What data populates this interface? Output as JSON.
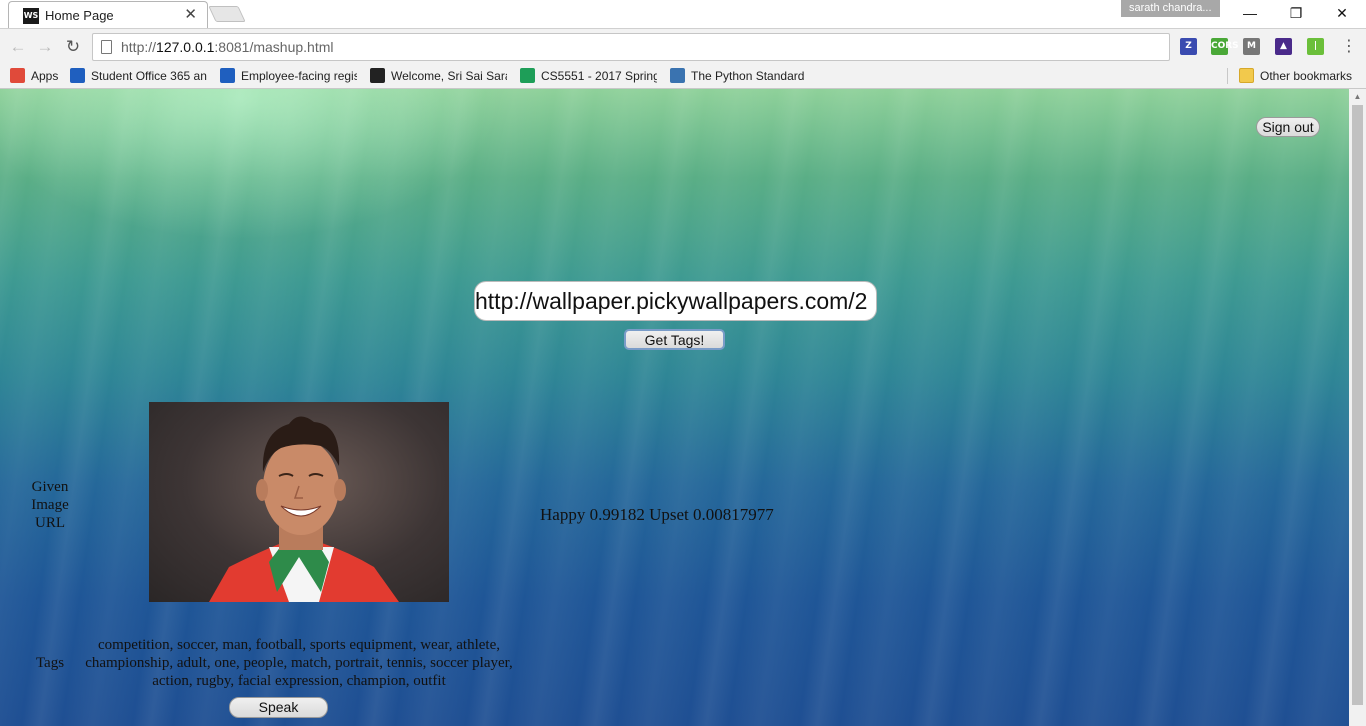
{
  "browser": {
    "tab": {
      "title": "Home Page",
      "favicon_text": "WS",
      "close_label": "✕"
    },
    "profile": "sarath chandra...",
    "address": {
      "prefix": "http://",
      "host": "127.0.0.1",
      "rest": ":8081/mashup.html"
    },
    "bookmarks": [
      {
        "label": "Apps",
        "icon": "apps-grid-icon",
        "color": "#e04a3a"
      },
      {
        "label": "Student Office 365 an",
        "icon": "office-icon",
        "color": "#1f5fbf"
      },
      {
        "label": "Employee-facing regis",
        "icon": "office-icon",
        "color": "#1f5fbf"
      },
      {
        "label": "Welcome, Sri Sai Sarat",
        "icon": "blackboard-icon",
        "color": "#222222"
      },
      {
        "label": "CS5551 - 2017 Spring",
        "icon": "sheets-icon",
        "color": "#1e9e58"
      },
      {
        "label": "The Python Standard L",
        "icon": "python-icon",
        "color": "#3a73b0"
      }
    ],
    "other_bookmarks": "Other bookmarks",
    "extensions": [
      {
        "name": "z-extension-icon",
        "text": "Z",
        "color": "#3a4bb0"
      },
      {
        "name": "cors-extension-icon",
        "text": "CORS",
        "color": "#4aa838"
      },
      {
        "name": "m-extension-icon",
        "text": "M",
        "color": "#777777"
      },
      {
        "name": "purple-extension-icon",
        "text": "▲",
        "color": "#4a2a8a"
      },
      {
        "name": "green-extension-icon",
        "text": "|",
        "color": "#6bbf3a"
      }
    ]
  },
  "page": {
    "signout_label": "Sign out",
    "url_value": "http://wallpaper.pickywallpapers.com/2",
    "gettags_label": "Get Tags!",
    "given_label": "Given Image URL",
    "tags_label": "Tags",
    "emotion": "Happy 0.99182 Upset 0.00817977",
    "tags": "competition, soccer, man, football, sports equipment, wear, athlete, championship, adult, one, people, match, portrait, tennis, soccer player, action, rugby, facial expression, champion, outfit",
    "speak_label": "Speak"
  }
}
